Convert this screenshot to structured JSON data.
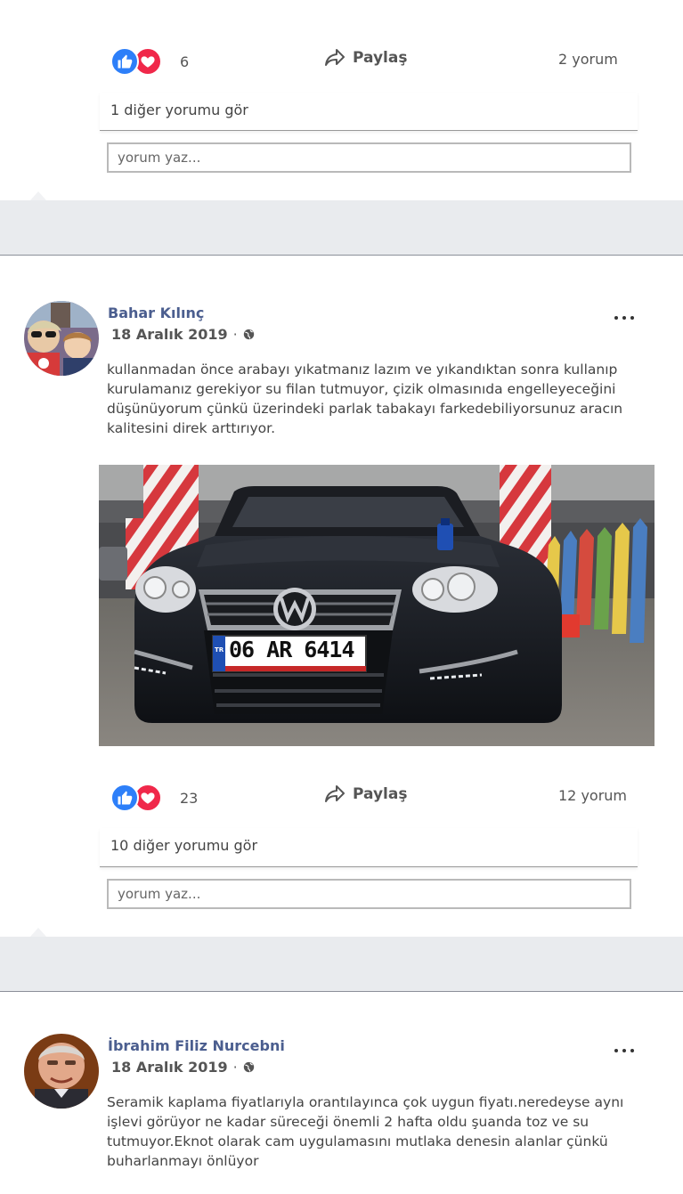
{
  "post1": {
    "reaction_count": "6",
    "share_label": "Paylaş",
    "comment_count": "2 yorum",
    "see_more": "1 diğer yorumu gör",
    "comment_placeholder": "yorum yaz..."
  },
  "post2": {
    "author": "Bahar Kılınç",
    "date": "18 Aralık 2019",
    "text": "kullanmadan önce arabayı yıkatmanız lazım ve yıkandıktan sonra kullanıp kurulamanız gerekiyor su filan tutmuyor, çizik olmasınıda engelleyeceğini düşünüyorum çünkü üzerindeki parlak tabakayı farkedebiliyorsunuz aracın kalitesini direk arttırıyor.",
    "plate": "06 AR 6414",
    "plate_country": "TR",
    "reaction_count": "23",
    "share_label": "Paylaş",
    "comment_count": "12 yorum",
    "see_more": "10 diğer yorumu gör",
    "comment_placeholder": "yorum yaz..."
  },
  "post3": {
    "author": "İbrahim Filiz Nurcebni",
    "date": "18 Aralık 2019",
    "text": "Seramik kaplama fiyatlarıyla orantılayınca çok uygun fiyatı.neredeyse aynı işlevi görüyor ne kadar süreceği önemli 2 hafta oldu şuanda toz ve su tutmuyor.Eknot olarak cam uygulamasını mutlaka denesin alanlar çünkü buharlanmayı önlüyor"
  },
  "colors": {
    "like": "#2d7ff9",
    "love": "#f0284a",
    "author": "#4b5e8f",
    "divider_bg": "#e9ebee"
  },
  "icons": {
    "like": "thumbs-up-icon",
    "love": "heart-icon",
    "share": "share-arrow-icon",
    "privacy": "globe-icon",
    "more": "more-options-icon"
  }
}
